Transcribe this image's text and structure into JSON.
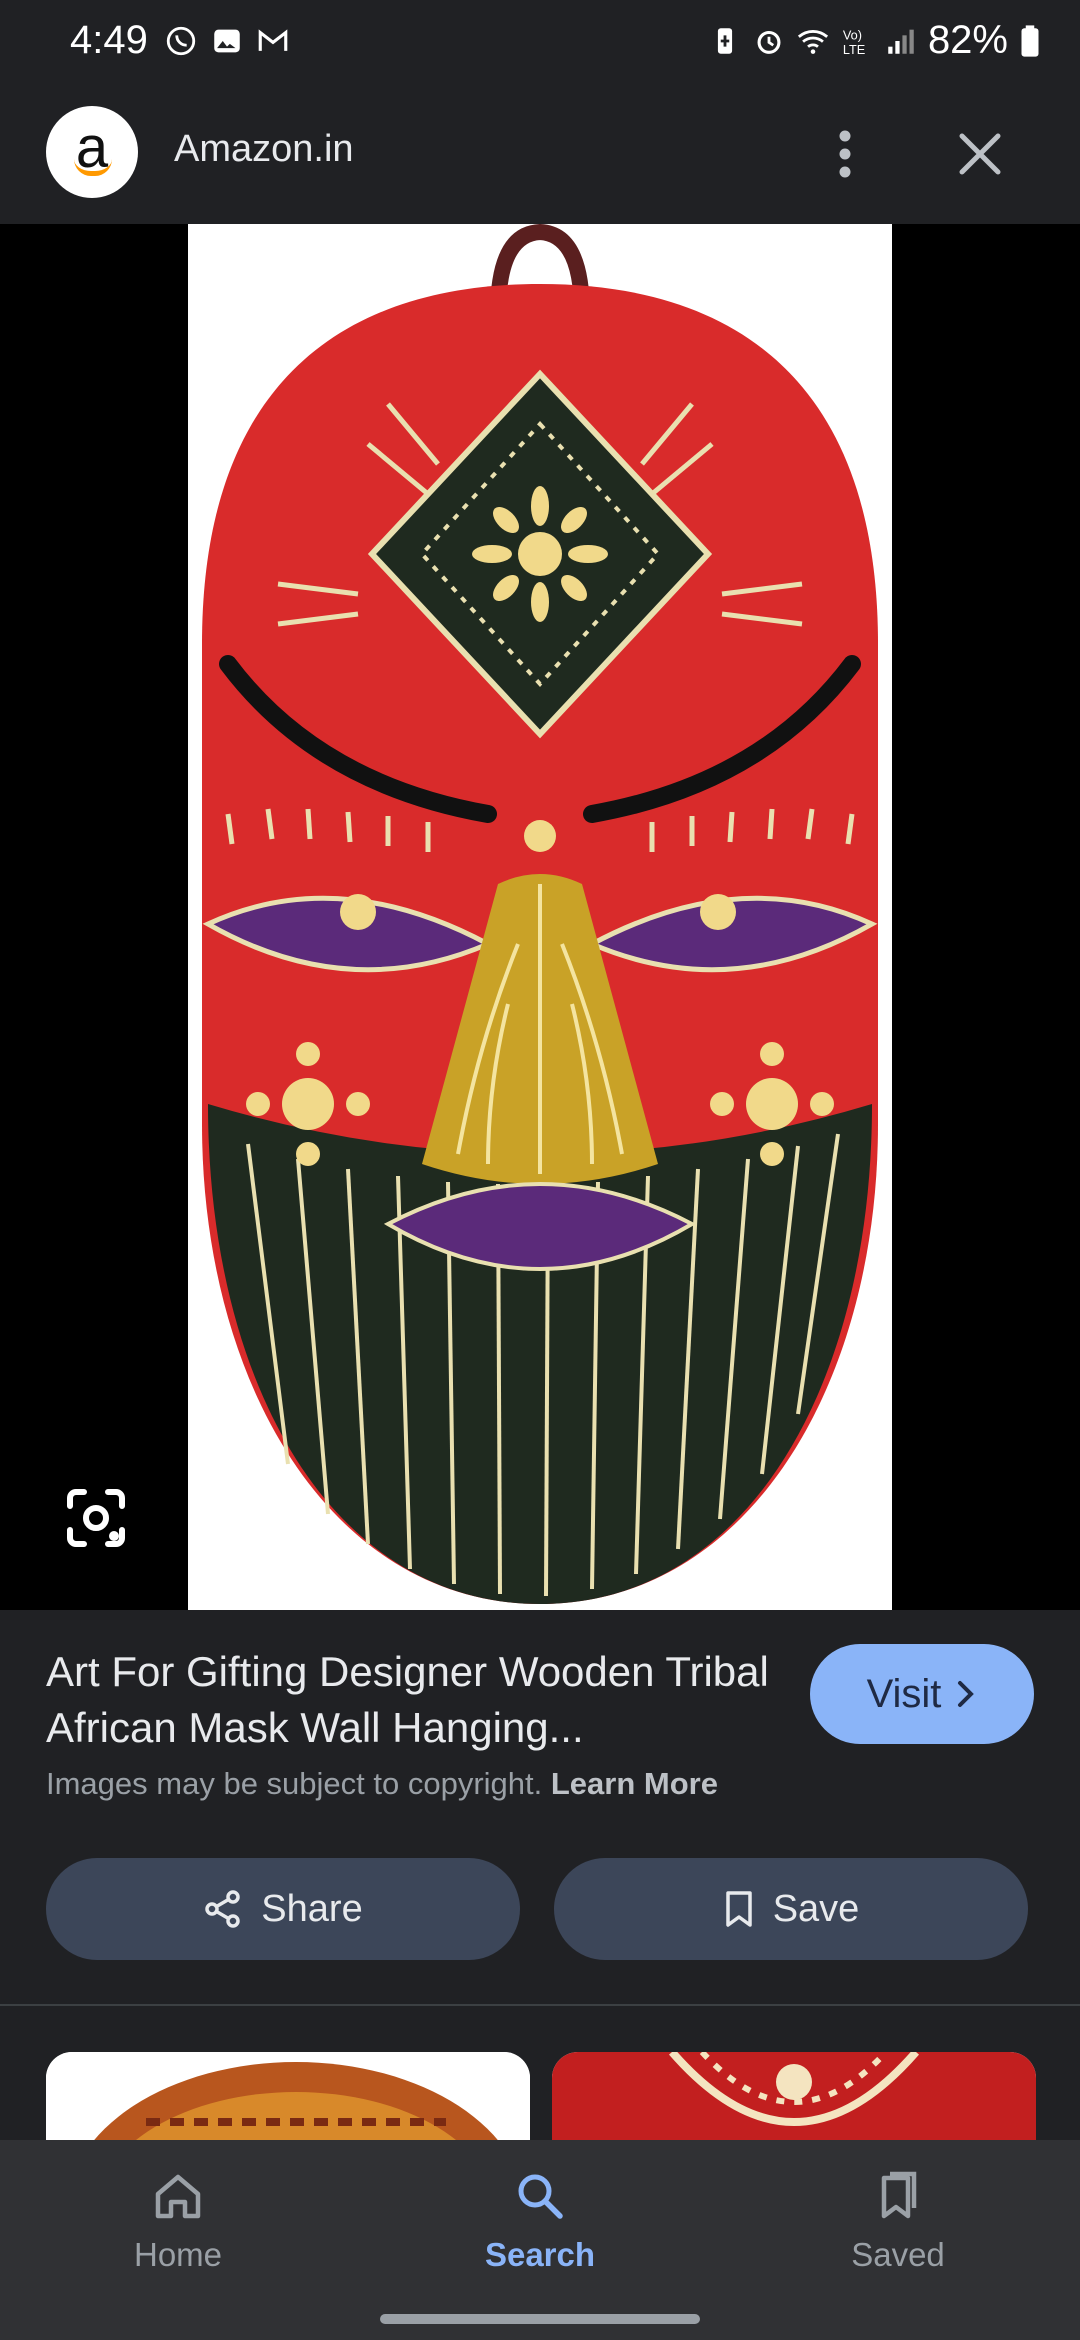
{
  "status_bar": {
    "time": "4:49",
    "battery": "82%",
    "icons": [
      "whatsapp-icon",
      "gallery-icon",
      "gmail-icon",
      "battery-saver-icon",
      "alarm-icon",
      "wifi-icon",
      "volte-icon",
      "signal-icon",
      "battery-icon"
    ]
  },
  "header": {
    "site": "Amazon.in",
    "logo_letter": "a",
    "menu_icon": "more-vert-icon",
    "close_icon": "close-icon"
  },
  "product": {
    "title": "Art For Gifting Designer Wooden Tribal African Mask Wall Hanging...",
    "visit_label": "Visit",
    "copyright_text": "Images may be subject to copyright.",
    "learn_more": "Learn More"
  },
  "actions": {
    "share_label": "Share",
    "save_label": "Save"
  },
  "nav": {
    "items": [
      {
        "label": "Home",
        "icon": "home-icon",
        "active": false
      },
      {
        "label": "Search",
        "icon": "search-icon",
        "active": true
      },
      {
        "label": "Saved",
        "icon": "saved-icon",
        "active": false
      }
    ]
  },
  "colors": {
    "background": "#202124",
    "accent": "#8ab4f8",
    "pill": "#3c4659",
    "nav": "#303134"
  }
}
